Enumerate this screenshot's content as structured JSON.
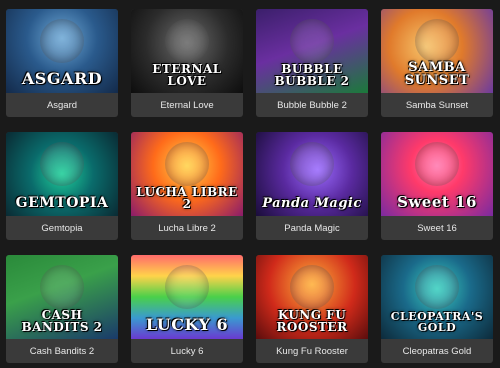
{
  "games": [
    {
      "title": "Asgard",
      "logo_text": "ASGARD"
    },
    {
      "title": "Eternal Love",
      "logo_text": "ETERNAL LOVE"
    },
    {
      "title": "Bubble Bubble 2",
      "logo_text": "BUBBLE BUBBLE 2"
    },
    {
      "title": "Samba Sunset",
      "logo_text": "SAMBA SUNSET"
    },
    {
      "title": "Gemtopia",
      "logo_text": "GEMTOPIA"
    },
    {
      "title": "Lucha Libre 2",
      "logo_text": "LUCHA LIBRE 2"
    },
    {
      "title": "Panda Magic",
      "logo_text": "Panda Magic"
    },
    {
      "title": "Sweet 16",
      "logo_text": "Sweet 16"
    },
    {
      "title": "Cash Bandits 2",
      "logo_text": "CASH BANDITS 2"
    },
    {
      "title": "Lucky 6",
      "logo_text": "LUCKY 6"
    },
    {
      "title": "Kung Fu Rooster",
      "logo_text": "KUNG FU ROOSTER"
    },
    {
      "title": "Cleopatras Gold",
      "logo_text": "CLEOPATRA'S GOLD"
    }
  ]
}
